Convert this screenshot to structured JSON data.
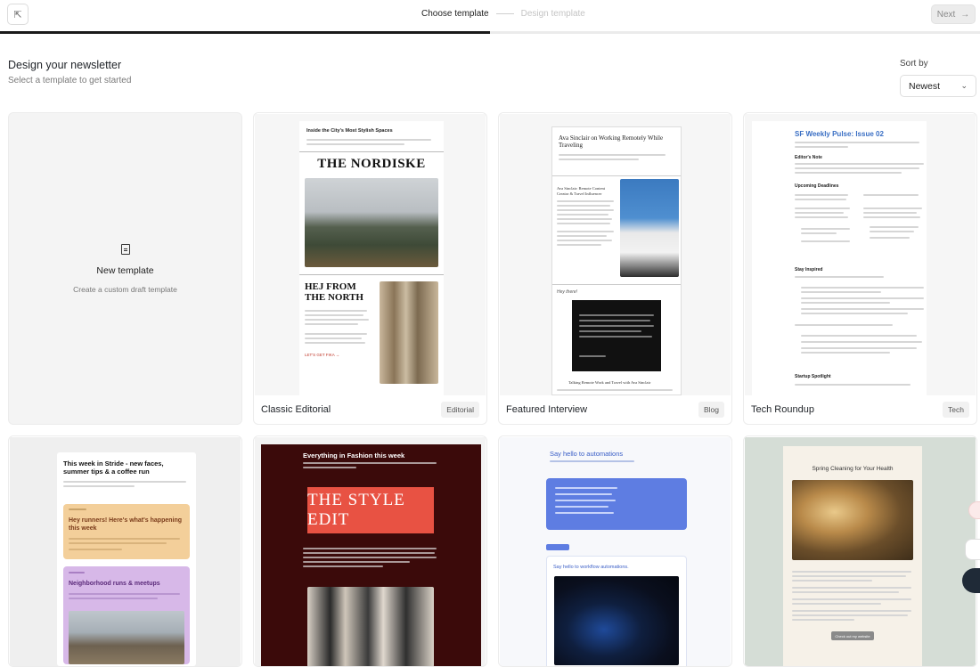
{
  "topbar": {
    "steps": [
      "Choose template",
      "Design template"
    ],
    "next_label": "Next",
    "progress": 0.5
  },
  "header": {
    "title": "Design your newsletter",
    "subtitle": "Select a template to get started",
    "sort_label": "Sort by",
    "sort_value": "Newest"
  },
  "new_template": {
    "title": "New template",
    "subtitle": "Create a custom draft template"
  },
  "templates": [
    {
      "name": "Classic Editorial",
      "tag": "Editorial",
      "preview": {
        "kicker": "Inside the City's Most Stylish Spaces",
        "masthead": "THE NORDISKE",
        "section": "HEJ FROM THE NORTH",
        "cta": "LET'S GET FIKA →"
      }
    },
    {
      "name": "Featured Interview",
      "tag": "Blog",
      "preview": {
        "headline": "Ava Sinclair on Working Remotely While Traveling",
        "sub": "Ava Sinclair: Remote Content Creator & Travel Influencer",
        "quote_label": "Hey there!",
        "bottom": "Talking Remote Work and Travel with Ava Sinclair"
      }
    },
    {
      "name": "Tech Roundup",
      "tag": "Tech",
      "preview": {
        "headline": "SF Weekly Pulse: Issue 02",
        "s1": "Editor's Note",
        "s2": "Upcoming Deadlines",
        "s3": "Stay Inspired",
        "s4": "Startup Spotlight"
      }
    },
    {
      "preview": {
        "headline": "This week in Stride - new faces, summer tips & a coffee run",
        "box1": "Hey runners! Here's what's happening this week",
        "box2": "Neighborhood runs & meetups"
      }
    },
    {
      "preview": {
        "headline": "Everything in Fashion this week",
        "masthead": "THE STYLE EDIT"
      }
    },
    {
      "preview": {
        "headline": "Say hello to automations",
        "sub": "Say hello to workflow automations."
      }
    },
    {
      "preview": {
        "headline": "Spring Cleaning for Your Health",
        "cta": "Check out my website"
      }
    }
  ]
}
